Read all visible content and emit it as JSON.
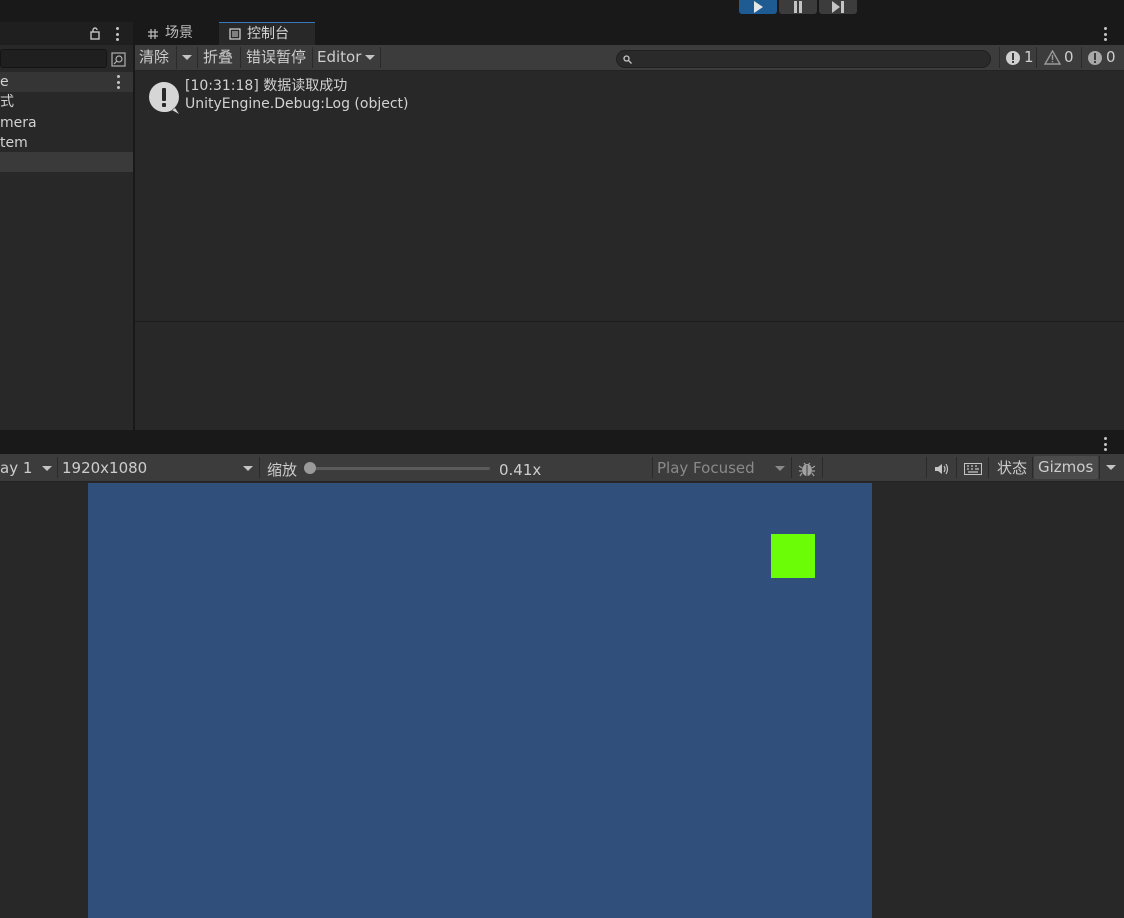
{
  "colors": {
    "accent": "#3a79bb",
    "play_active": "#1e5b92",
    "viewport_bg": "#304f7b",
    "game_object": "#6afd06"
  },
  "hierarchy": {
    "items": [
      {
        "label": "e"
      },
      {
        "label": "式"
      },
      {
        "label": "mera"
      },
      {
        "label": "tem"
      }
    ]
  },
  "console": {
    "tabs": [
      {
        "label": "场景",
        "icon": "grid-icon"
      },
      {
        "label": "控制台",
        "icon": "console-icon"
      }
    ],
    "toolbar": {
      "clear_label": "清除",
      "collapse_label": "折叠",
      "error_pause_label": "错误暂停",
      "editor_label": "Editor"
    },
    "search": {
      "placeholder": ""
    },
    "counts": {
      "errors": "1",
      "warnings": "0",
      "infos": "0"
    },
    "log": {
      "line1": "[10:31:18] 数据读取成功",
      "line2": "UnityEngine.Debug:Log (object)"
    }
  },
  "game": {
    "display_label": "ay 1",
    "resolution_label": "1920x1080",
    "scale_label": "缩放",
    "scale_value": "0.41x",
    "scale_fraction": 0.0,
    "play_mode_label": "Play Focused",
    "stats_label": "状态",
    "gizmos_label": "Gizmos"
  }
}
